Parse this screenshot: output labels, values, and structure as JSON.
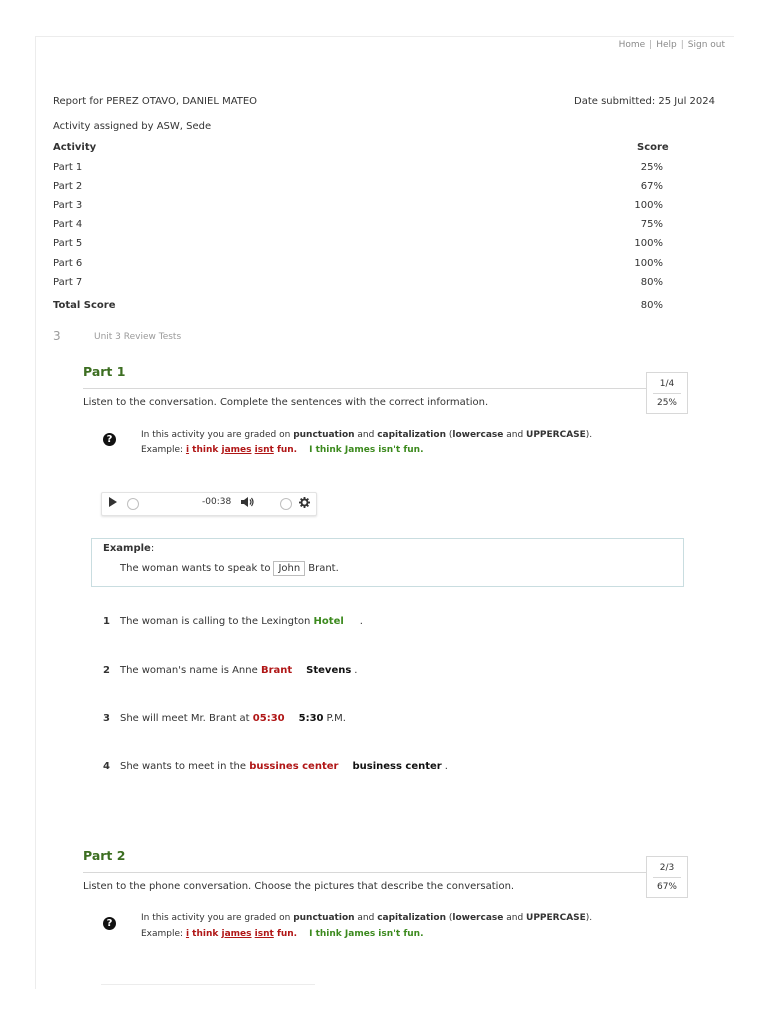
{
  "nav": {
    "home": "Home",
    "help": "Help",
    "signout": "Sign out",
    "sep": "|"
  },
  "report": {
    "for": "Report for PEREZ OTAVO, DANIEL MATEO",
    "date": "Date submitted: 25 Jul 2024",
    "assigned": "Activity assigned by ASW, Sede",
    "col_activity": "Activity",
    "col_score": "Score",
    "rows": [
      {
        "name": "Part 1",
        "score": "25%"
      },
      {
        "name": "Part 2",
        "score": "67%"
      },
      {
        "name": "Part 3",
        "score": "100%"
      },
      {
        "name": "Part 4",
        "score": "75%"
      },
      {
        "name": "Part 5",
        "score": "100%"
      },
      {
        "name": "Part 6",
        "score": "100%"
      },
      {
        "name": "Part 7",
        "score": "80%"
      }
    ],
    "total_label": "Total Score",
    "total_score": "80%"
  },
  "unit": {
    "number": "3",
    "title": "Unit 3 Review Tests"
  },
  "grading_note": {
    "pre": "In this activity you are graded on ",
    "punct": "punctuation",
    "and1": " and ",
    "cap": "capitalization",
    "paren_open": " (",
    "lower": "lowercase",
    "and2": " and ",
    "upper": "UPPERCASE",
    "paren_close": ").",
    "example_label": "Example: ",
    "wrong_i": "i",
    "wrong_think": " think ",
    "wrong_james": "james",
    "wrong_space": " ",
    "wrong_isnt": "isnt",
    "wrong_fun": " fun.",
    "correct": "I think James isn't fun."
  },
  "part1": {
    "title": "Part 1",
    "score_fraction": "1/4",
    "score_percent": "25%",
    "instruction": "Listen to the conversation. Complete the sentences with the correct information.",
    "player": {
      "time": "-00:38"
    },
    "example": {
      "label": "Example",
      "colon": ":",
      "pre": "The woman wants to speak to",
      "answer": "John",
      "post": "Brant."
    },
    "questions": [
      {
        "num": "1",
        "pre": "The woman is calling to the Lexington ",
        "answer": "Hotel",
        "correct": "",
        "post": "."
      },
      {
        "num": "2",
        "pre": "The woman's name is Anne ",
        "answer": "Brant",
        "correct": "Stevens",
        "post": "."
      },
      {
        "num": "3",
        "pre": "She will meet Mr. Brant at ",
        "answer": "05:30",
        "correct": "5:30",
        "post": "P.M."
      },
      {
        "num": "4",
        "pre": "She wants to meet in the ",
        "answer": "bussines center",
        "correct": "business center",
        "post": "."
      }
    ]
  },
  "part2": {
    "title": "Part 2",
    "score_fraction": "2/3",
    "score_percent": "67%",
    "instruction": "Listen to the phone conversation. Choose the pictures that describe the conversation."
  },
  "colors": {
    "green_heading": "#3c6e21",
    "wrong": "#b01616",
    "correct": "#3c8a1e"
  }
}
